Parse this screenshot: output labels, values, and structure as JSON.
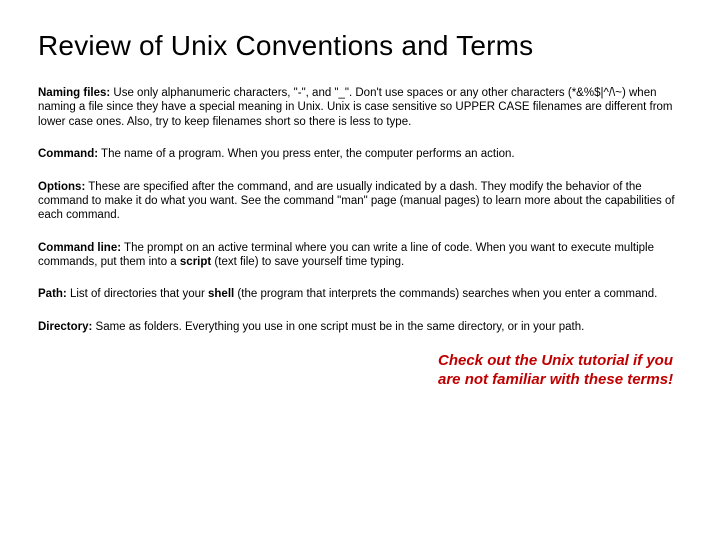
{
  "title": "Review of Unix Conventions and Terms",
  "entries": [
    {
      "term": "Naming files:",
      "desc": " Use only alphanumeric characters, \"-\", and \"_\". Don't use spaces or any other characters (*&%$|^/\\~) when naming a file since they have a special meaning in Unix. Unix is case sensitive so UPPER CASE filenames are different from lower case ones. Also, try to keep filenames short so there is less to type."
    },
    {
      "term": "Command:",
      "desc": " The name of a program. When you press enter, the computer performs an action."
    },
    {
      "term": "Options:",
      "desc": " These are specified after the command, and are usually indicated by a dash. They modify the behavior of the command to make it do what you want. See the command \"man\" page (manual pages) to learn more about the capabilities of each command."
    },
    {
      "term": "Command line:",
      "desc_pre": " The prompt on an active terminal where you can write a line of code. When you want to execute multiple commands, put them into a ",
      "inline_bold": "script",
      "desc_post": " (text file) to save yourself time typing."
    },
    {
      "term": "Path:",
      "desc_pre": " List of directories that your ",
      "inline_bold": "shell",
      "desc_post": " (the program that interprets the commands) searches when you enter a command."
    },
    {
      "term": "Directory:",
      "desc": " Same as folders. Everything you use in one script must be in the same directory, or in your path."
    }
  ],
  "callout": "Check out the Unix tutorial if you are not familiar with these terms!"
}
